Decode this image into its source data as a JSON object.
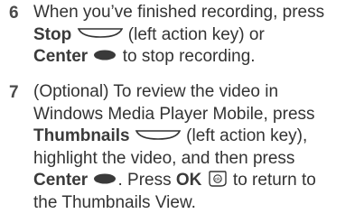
{
  "steps": [
    {
      "number": "6",
      "lines": [
        {
          "text": "When you’ve finished recording, press"
        },
        {
          "bold": "Stop",
          "after": " (left action key) or"
        },
        {
          "bold": "Center",
          "after": " to stop recording."
        }
      ]
    },
    {
      "number": "7",
      "lines": [
        {
          "text": "(Optional) To review the video in"
        },
        {
          "text": "Windows Media Player Mobile, press"
        },
        {
          "bold": "Thumbnails",
          "after": " (left action key),"
        },
        {
          "text": "highlight the video, and then press"
        },
        {
          "bold": "Center",
          "mid": ". Press ",
          "bold2": "OK",
          "after": " to return to"
        },
        {
          "text": "the Thumbnails View."
        }
      ]
    }
  ],
  "icons": {
    "left_action_key": "left-action-key-icon",
    "center_button": "center-button-icon",
    "ok_button": "ok-button-icon"
  }
}
